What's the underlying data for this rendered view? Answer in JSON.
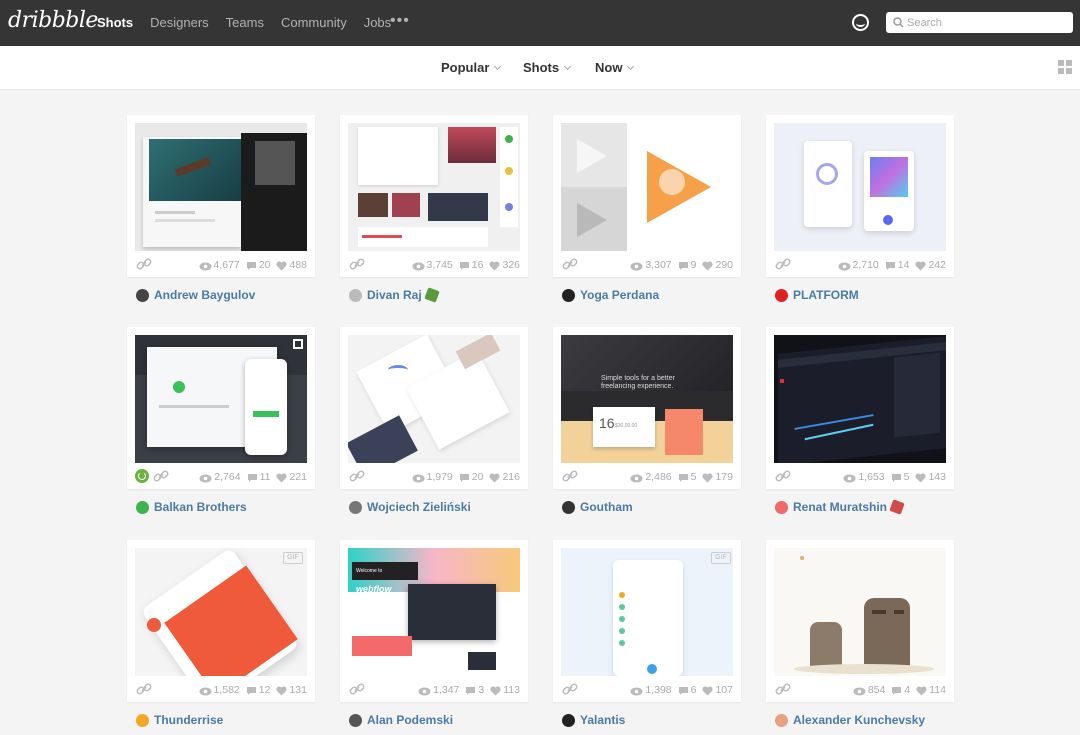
{
  "nav": {
    "logo": "dribbble",
    "items": [
      {
        "label": "Shots",
        "active": true
      },
      {
        "label": "Designers",
        "active": false
      },
      {
        "label": "Teams",
        "active": false
      },
      {
        "label": "Community",
        "active": false
      },
      {
        "label": "Jobs",
        "active": false
      }
    ],
    "more": "•••",
    "search_placeholder": "Search"
  },
  "filters": {
    "sort": "Popular",
    "list": "Shots",
    "timeframe": "Now"
  },
  "shots": [
    {
      "views": "4,677",
      "comments": "20",
      "likes": "488",
      "author": "Andrew Baygulov",
      "rebound": false
    },
    {
      "views": "3,745",
      "comments": "16",
      "likes": "326",
      "author": "Divan Raj",
      "rebound": false
    },
    {
      "views": "3,307",
      "comments": "9",
      "likes": "290",
      "author": "Yoga Perdana",
      "rebound": false
    },
    {
      "views": "2,710",
      "comments": "14",
      "likes": "242",
      "author": "PLATFORM",
      "rebound": false
    },
    {
      "views": "2,764",
      "comments": "11",
      "likes": "221",
      "author": "Balkan Brothers",
      "rebound": true
    },
    {
      "views": "1,979",
      "comments": "20",
      "likes": "216",
      "author": "Wojciech Zieliński",
      "rebound": false
    },
    {
      "views": "2,486",
      "comments": "5",
      "likes": "179",
      "author": "Goutham",
      "rebound": false
    },
    {
      "views": "1,653",
      "comments": "5",
      "likes": "143",
      "author": "Renat Muratshin",
      "rebound": false
    },
    {
      "views": "1,582",
      "comments": "12",
      "likes": "131",
      "author": "Thunderrise",
      "rebound": false
    },
    {
      "views": "1,347",
      "comments": "3",
      "likes": "113",
      "author": "Alan Podemski",
      "rebound": false
    },
    {
      "views": "1,398",
      "comments": "6",
      "likes": "107",
      "author": "Yalantis",
      "rebound": false
    },
    {
      "views": "854",
      "comments": "4",
      "likes": "114",
      "author": "Alexander Kunchevsky",
      "rebound": false
    }
  ],
  "thumb_text": {
    "webflow_prefix": "Welcome to",
    "webflow_word": "webflow",
    "goutham_line1": "Simple tools for a better",
    "goutham_line2": "freelancing experience.",
    "goutham_date": "16",
    "goutham_amount": "$30,00.00",
    "gif_label": "GIF"
  },
  "colors": {
    "nav_bg": "#353535",
    "link_blue": "#4a7ba6",
    "page_bg": "#f4f4f4"
  }
}
